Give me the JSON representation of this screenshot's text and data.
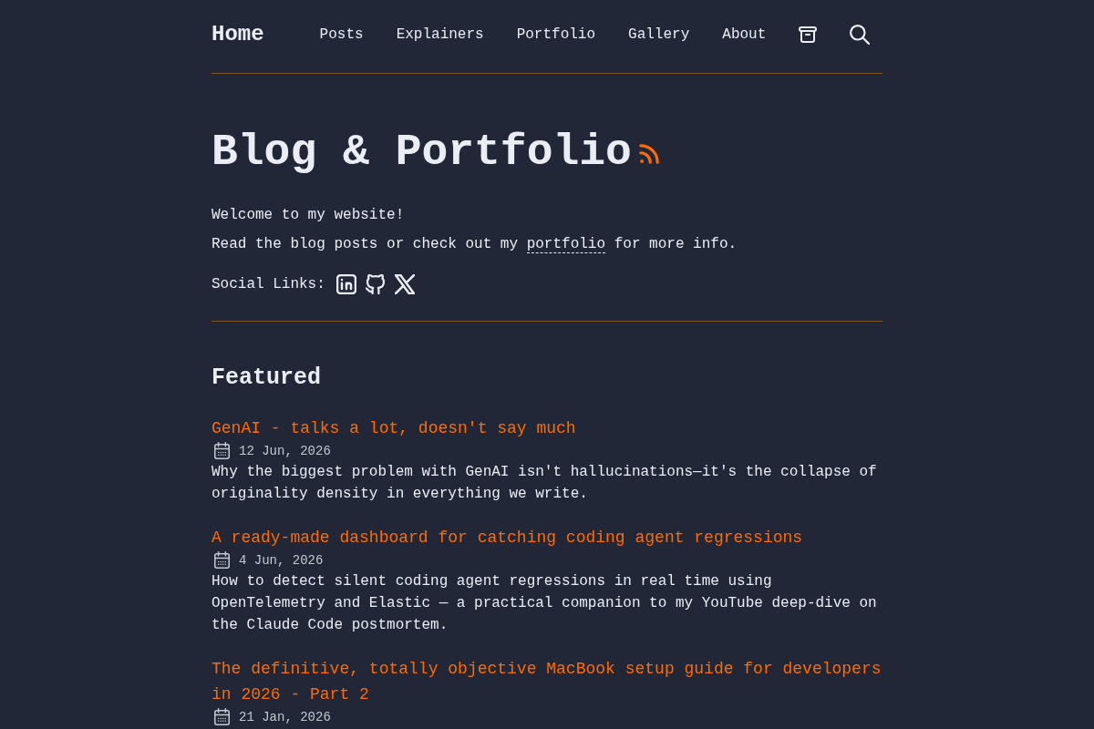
{
  "nav": {
    "brand": "Home",
    "items": [
      "Posts",
      "Explainers",
      "Portfolio",
      "Gallery",
      "About"
    ]
  },
  "hero": {
    "title": "Blog & Portfolio",
    "welcome": "Welcome to my website!",
    "blurb": {
      "before": "Read the blog posts or check out my ",
      "link": "portfolio",
      "after": " for more info."
    },
    "social_label": "Social Links:"
  },
  "featured": {
    "heading": "Featured",
    "posts": [
      {
        "title": "GenAI - talks a lot, doesn't say much",
        "date": "12 Jun, 2026",
        "description": "Why the biggest problem with GenAI isn't hallucinations—it's the collapse of originality density in everything we write."
      },
      {
        "title": "A ready-made dashboard for catching coding agent regressions",
        "date": "4 Jun, 2026",
        "description": "How to detect silent coding agent regressions in real time using OpenTelemetry and Elastic — a practical companion to my YouTube deep-dive on the Claude Code postmortem."
      },
      {
        "title": "The definitive, totally objective MacBook setup guide for developers in 2026 - Part 2",
        "date": "21 Jan, 2026"
      }
    ]
  }
}
